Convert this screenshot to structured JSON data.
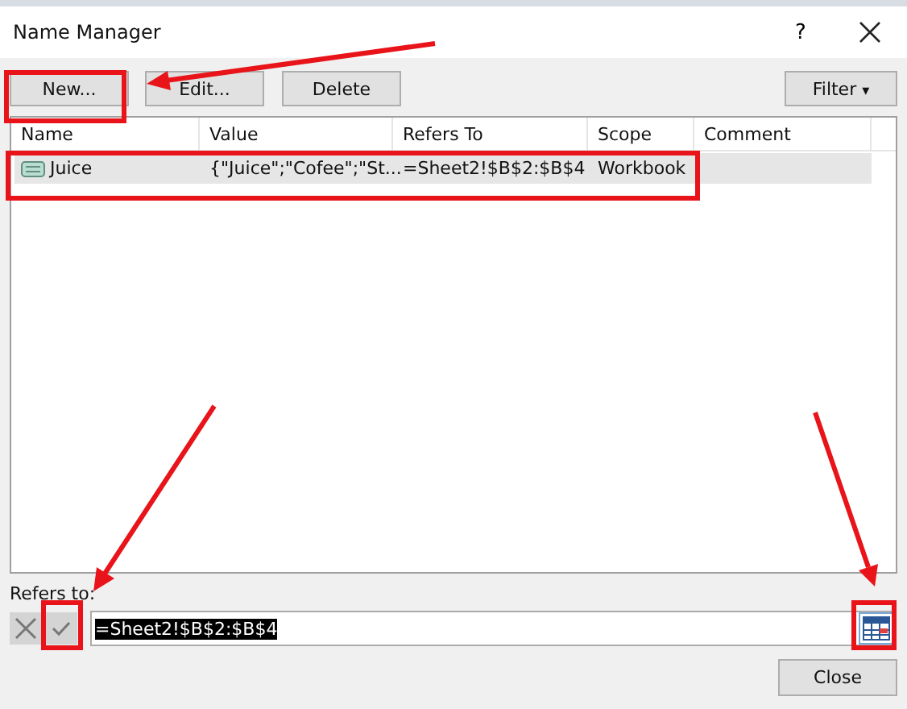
{
  "window": {
    "title": "Name Manager",
    "help": "?"
  },
  "toolbar": {
    "buttons": [
      {
        "label": "New..."
      },
      {
        "label": "Edit..."
      },
      {
        "label": "Delete"
      }
    ],
    "filter": {
      "label": "Filter",
      "caret": "▾"
    }
  },
  "table": {
    "columns": [
      "Name",
      "Value",
      "Refers To",
      "Scope",
      "Comment"
    ],
    "rows": [
      {
        "selected": true,
        "cells": [
          "Juice",
          "{\"Juice\";\"Cofee\";\"St...",
          "=Sheet2!$B$2:$B$4",
          "Workbook",
          ""
        ]
      }
    ]
  },
  "refers_to": {
    "label": "Refers to:",
    "value": "=Sheet2!$B$2:$B$4",
    "value_selected": true
  },
  "buttons": {
    "close": "Close"
  }
}
